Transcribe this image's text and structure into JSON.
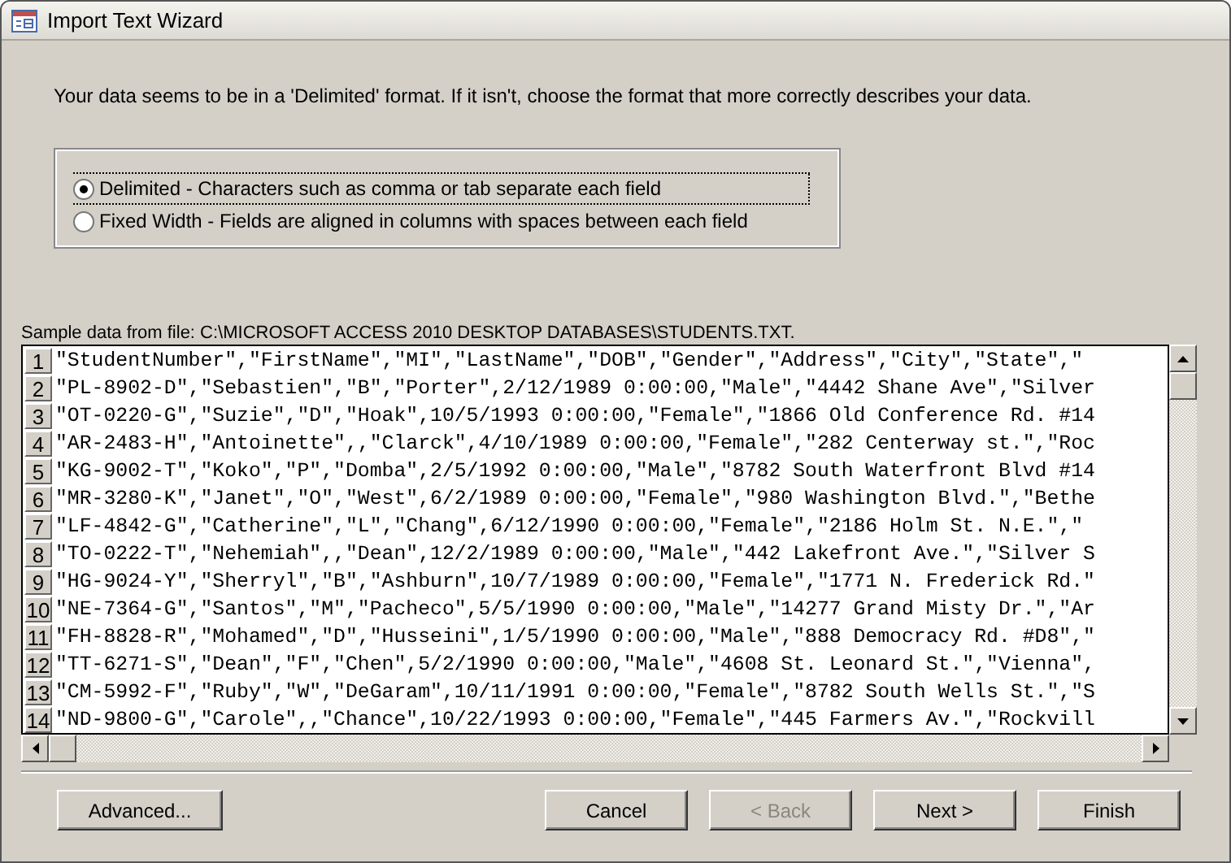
{
  "window": {
    "title": "Import Text Wizard"
  },
  "intro": "Your data seems to be in a 'Delimited' format. If it isn't, choose the format that more correctly describes your data.",
  "format_options": [
    {
      "label": "Delimited - Characters such as comma or tab separate each field",
      "selected": true
    },
    {
      "label": "Fixed Width - Fields are aligned in columns with spaces between each field",
      "selected": false
    }
  ],
  "sample_label": "Sample data from file: C:\\MICROSOFT ACCESS 2010 DESKTOP DATABASES\\STUDENTS.TXT.",
  "rows": [
    {
      "number": "1",
      "text": "\"StudentNumber\",\"FirstName\",\"MI\",\"LastName\",\"DOB\",\"Gender\",\"Address\",\"City\",\"State\",\""
    },
    {
      "number": "2",
      "text": "\"PL-8902-D\",\"Sebastien\",\"B\",\"Porter\",2/12/1989 0:00:00,\"Male\",\"4442 Shane Ave\",\"Silver"
    },
    {
      "number": "3",
      "text": "\"OT-0220-G\",\"Suzie\",\"D\",\"Hoak\",10/5/1993 0:00:00,\"Female\",\"1866 Old Conference Rd. #14"
    },
    {
      "number": "4",
      "text": "\"AR-2483-H\",\"Antoinette\",,\"Clarck\",4/10/1989 0:00:00,\"Female\",\"282 Centerway st.\",\"Roc"
    },
    {
      "number": "5",
      "text": "\"KG-9002-T\",\"Koko\",\"P\",\"Domba\",2/5/1992 0:00:00,\"Male\",\"8782 South Waterfront Blvd #14"
    },
    {
      "number": "6",
      "text": "\"MR-3280-K\",\"Janet\",\"O\",\"West\",6/2/1989 0:00:00,\"Female\",\"980 Washington Blvd.\",\"Bethe"
    },
    {
      "number": "7",
      "text": "\"LF-4842-G\",\"Catherine\",\"L\",\"Chang\",6/12/1990 0:00:00,\"Female\",\"2186 Holm St. N.E.\",\""
    },
    {
      "number": "8",
      "text": "\"TO-0222-T\",\"Nehemiah\",,\"Dean\",12/2/1989 0:00:00,\"Male\",\"442 Lakefront Ave.\",\"Silver S"
    },
    {
      "number": "9",
      "text": "\"HG-9024-Y\",\"Sherryl\",\"B\",\"Ashburn\",10/7/1989 0:00:00,\"Female\",\"1771 N. Frederick Rd.\""
    },
    {
      "number": "10",
      "text": "\"NE-7364-G\",\"Santos\",\"M\",\"Pacheco\",5/5/1990 0:00:00,\"Male\",\"14277 Grand Misty Dr.\",\"Ar"
    },
    {
      "number": "11",
      "text": "\"FH-8828-R\",\"Mohamed\",\"D\",\"Husseini\",1/5/1990 0:00:00,\"Male\",\"888 Democracy Rd. #D8\",\""
    },
    {
      "number": "12",
      "text": "\"TT-6271-S\",\"Dean\",\"F\",\"Chen\",5/2/1990 0:00:00,\"Male\",\"4608 St. Leonard St.\",\"Vienna\","
    },
    {
      "number": "13",
      "text": "\"CM-5992-F\",\"Ruby\",\"W\",\"DeGaram\",10/11/1991 0:00:00,\"Female\",\"8782 South Wells St.\",\"S"
    },
    {
      "number": "14",
      "text": "\"ND-9800-G\",\"Carole\",,\"Chance\",10/22/1993 0:00:00,\"Female\",\"445 Farmers Av.\",\"Rockvill"
    }
  ],
  "buttons": [
    {
      "label": "Advanced...",
      "disabled": false
    },
    {
      "label": "Cancel",
      "disabled": false
    },
    {
      "label": "< Back",
      "disabled": true
    },
    {
      "label": "Next >",
      "disabled": false
    },
    {
      "label": "Finish",
      "disabled": false
    }
  ]
}
